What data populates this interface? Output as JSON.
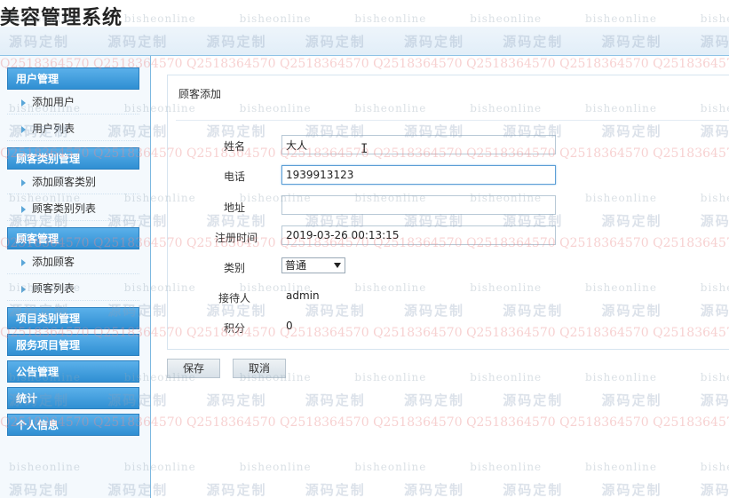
{
  "app": {
    "title": "美容管理系统"
  },
  "sidebar": {
    "groups": [
      {
        "label": "用户管理",
        "items": [
          "添加用户",
          "用户列表"
        ]
      },
      {
        "label": "顾客类别管理",
        "items": [
          "添加顾客类别",
          "顾客类别列表"
        ]
      },
      {
        "label": "顾客管理",
        "items": [
          "添加顾客",
          "顾客列表"
        ]
      },
      {
        "label": "项目类别管理",
        "items": []
      },
      {
        "label": "服务项目管理",
        "items": []
      },
      {
        "label": "公告管理",
        "items": []
      },
      {
        "label": "统计",
        "items": []
      },
      {
        "label": "个人信息",
        "items": []
      }
    ]
  },
  "panel": {
    "title": "顾客添加"
  },
  "form": {
    "name": {
      "label": "姓名",
      "value": "大人"
    },
    "phone": {
      "label": "电话",
      "value": "1939913123"
    },
    "address": {
      "label": "地址",
      "value": ""
    },
    "reg_time": {
      "label": "注册时间",
      "value": "2019-03-26 00:13:15"
    },
    "category": {
      "label": "类别",
      "value": "普通"
    },
    "receptionist": {
      "label": "接待人",
      "value": "admin"
    },
    "points": {
      "label": "积分",
      "value": "0"
    }
  },
  "buttons": {
    "save": "保存",
    "cancel": "取消"
  },
  "watermark": {
    "en": "bisheonline",
    "cn": "源码定制",
    "qq": "Q2518364570"
  }
}
